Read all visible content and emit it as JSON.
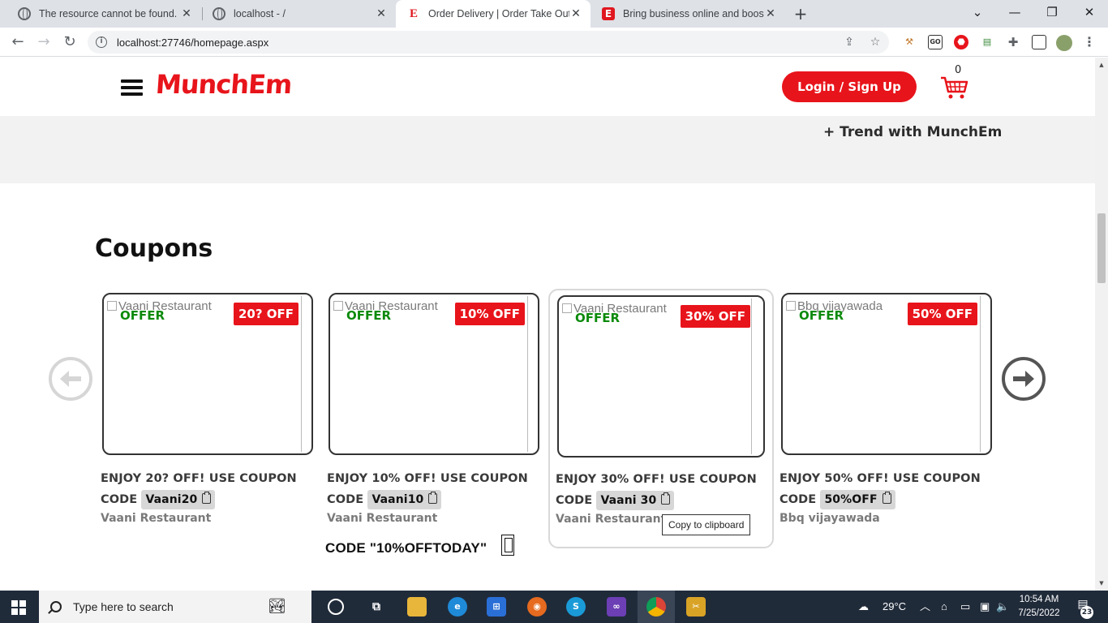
{
  "browser": {
    "tabs": [
      {
        "title": "The resource cannot be found.",
        "favicon": "globe-icon"
      },
      {
        "title": "localhost - /",
        "favicon": "globe-icon"
      },
      {
        "title": "Order Delivery | Order Take Out |",
        "favicon": "munchem-e-icon"
      },
      {
        "title": "Bring business online and boost",
        "favicon": "munchem-e-box-icon"
      }
    ],
    "new_tab": "+",
    "url": "localhost:27746/homepage.aspx"
  },
  "site": {
    "logo": "MunchEm",
    "login_label": "Login / Sign Up",
    "cart_count": "0",
    "trend_text": "+ Trend with MunchEm",
    "section_title": "Coupons"
  },
  "coupons": [
    {
      "alt": "Vaani Restaurant",
      "offer": "OFFER",
      "badge": "20? OFF",
      "desc": "ENJOY 20? OFF! USE COUPON CODE",
      "code": "Vaani20",
      "restaurant": "Vaani Restaurant"
    },
    {
      "alt": "Vaani Restaurant",
      "offer": "OFFER",
      "badge": "10% OFF",
      "desc": "ENJOY 10% OFF! USE COUPON CODE",
      "code": "Vaani10",
      "restaurant": "Vaani Restaurant"
    },
    {
      "alt": "Vaani Restaurant",
      "offer": "OFFER",
      "badge": "30% OFF",
      "desc": "ENJOY 30% OFF! USE COUPON CODE",
      "code": "Vaani 30",
      "restaurant": "Vaani Restaurant"
    },
    {
      "alt": "Bbq vijayawada",
      "offer": "OFFER",
      "badge": "50% OFF",
      "desc": "ENJOY 50% OFF! USE COUPON CODE",
      "code": "50%OFF",
      "restaurant": "Bbq vijayawada"
    }
  ],
  "tooltip": "Copy to clipboard",
  "promo": "CODE \"10%OFFTODAY\"",
  "taskbar": {
    "search_placeholder": "Type here to search",
    "temperature": "29°C",
    "time": "10:54 AM",
    "date": "7/25/2022",
    "notifications": "23"
  },
  "colors": {
    "brand_red": "#e8141b",
    "offer_green": "#0b8a0b"
  }
}
